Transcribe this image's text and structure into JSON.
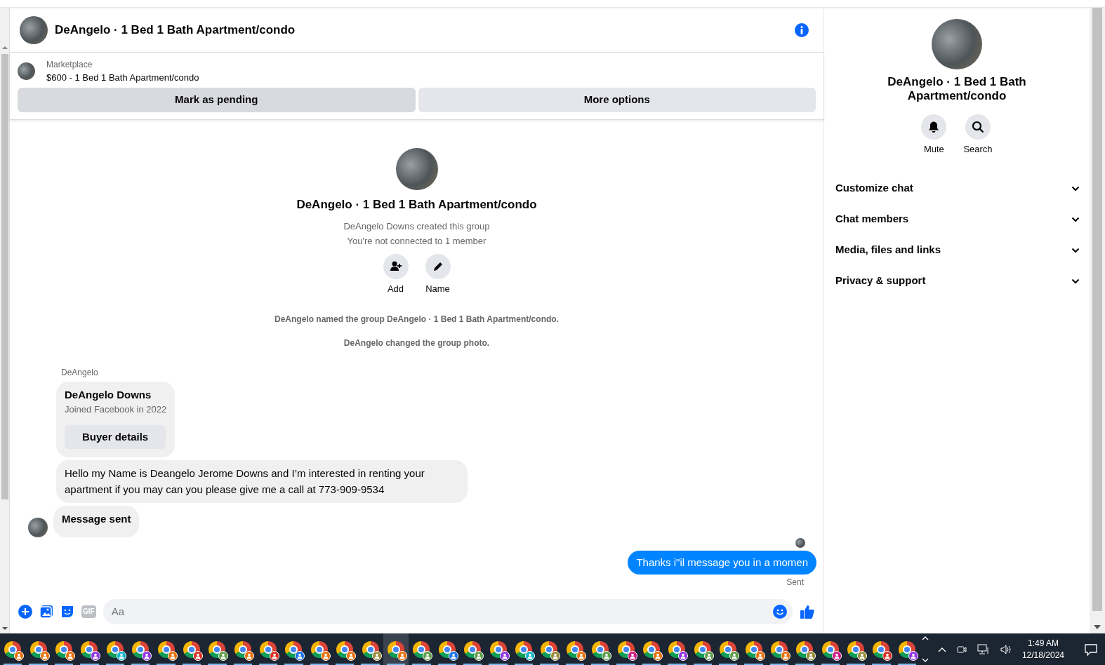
{
  "header": {
    "title": "DeAngelo · 1 Bed 1 Bath Apartment/condo"
  },
  "listing": {
    "source": "Marketplace",
    "title": "$600 - 1 Bed 1 Bath Apartment/condo",
    "buttons": [
      "Mark as pending",
      "More options"
    ]
  },
  "group_intro": {
    "title": "DeAngelo · 1 Bed 1 Bath Apartment/condo",
    "lines": [
      "DeAngelo Downs created this group",
      "You're not connected to 1 member"
    ],
    "actions": [
      {
        "kind": "add",
        "label": "Add"
      },
      {
        "kind": "name",
        "label": "Name"
      }
    ]
  },
  "events": [
    "DeAngelo named the group DeAngelo · 1 Bed 1 Bath Apartment/condo.",
    "DeAngelo changed the group photo."
  ],
  "messages": [
    {
      "kind": "profile",
      "sender": "DeAngelo",
      "name": "DeAngelo Downs",
      "detail": "Joined Facebook in 2022",
      "button": "Buyer details"
    },
    {
      "kind": "text",
      "text": "Hello my Name is Deangelo Jerome Downs and I’m interested in renting your apartment if you may can you please give me a call at 773-909-9534"
    },
    {
      "kind": "status",
      "text": "Message sent"
    },
    {
      "kind": "outgoing",
      "text": "Thanks i\"il message you in a momen",
      "status": "Sent"
    }
  ],
  "composer": {
    "gif_label": "GIF",
    "placeholder": "Aa"
  },
  "details": {
    "title": "DeAngelo · 1 Bed 1 Bath Apartment/condo",
    "actions": [
      {
        "kind": "mute",
        "label": "Mute"
      },
      {
        "kind": "search",
        "label": "Search"
      }
    ],
    "sections": [
      {
        "label": "Customize chat",
        "expanded": false
      },
      {
        "label": "Chat members",
        "expanded": false
      },
      {
        "label": "Media, files and links",
        "expanded": false
      },
      {
        "label": "Privacy & support",
        "expanded": false
      }
    ]
  },
  "taskbar": {
    "apps": [
      {
        "color": "#e8710a",
        "selected": false
      },
      {
        "color": "#e8710a",
        "selected": false
      },
      {
        "color": "#e8710a",
        "selected": false
      },
      {
        "color": "#9334e6",
        "selected": false
      },
      {
        "color": "#12b5cb",
        "selected": false
      },
      {
        "color": "#9334e6",
        "selected": false
      },
      {
        "color": "#e8710a",
        "selected": false
      },
      {
        "color": "#d93025",
        "selected": false
      },
      {
        "color": "#5f9e4a",
        "selected": false
      },
      {
        "color": "#e8710a",
        "selected": false
      },
      {
        "color": "#d93025",
        "selected": false
      },
      {
        "color": "#1a73e8",
        "selected": false
      },
      {
        "color": "#e8710a",
        "selected": false
      },
      {
        "color": "#e8710a",
        "selected": false
      },
      {
        "color": "#9a8c3a",
        "selected": false
      },
      {
        "color": "#e8710a",
        "selected": true
      },
      {
        "color": "#5f9e4a",
        "selected": false
      },
      {
        "color": "#1a73e8",
        "selected": false
      },
      {
        "color": "#5f9e4a",
        "selected": false
      },
      {
        "color": "#9334e6",
        "selected": false
      },
      {
        "color": "#12b5cb",
        "selected": false
      },
      {
        "color": "#9a8c3a",
        "selected": false
      },
      {
        "color": "#e8710a",
        "selected": false
      },
      {
        "color": "#5f9e4a",
        "selected": false
      },
      {
        "color": "#d01884",
        "selected": false
      },
      {
        "color": "#e8710a",
        "selected": false
      },
      {
        "color": "#9334e6",
        "selected": false
      },
      {
        "color": "#5f9e4a",
        "selected": false
      },
      {
        "color": "#5f9e4a",
        "selected": false
      },
      {
        "color": "#e8710a",
        "selected": false
      },
      {
        "color": "#e8710a",
        "selected": false
      },
      {
        "color": "#9a8c3a",
        "selected": false
      },
      {
        "color": "#d01884",
        "selected": false
      },
      {
        "color": "#9a8c3a",
        "selected": false
      },
      {
        "color": "#d93025",
        "selected": false
      },
      {
        "color": "#9334e6",
        "selected": false
      }
    ],
    "time": "1:49 AM",
    "date": "12/18/2024"
  }
}
